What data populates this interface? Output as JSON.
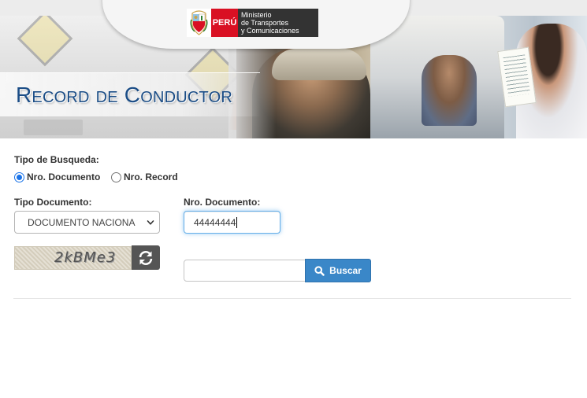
{
  "header": {
    "logo": {
      "country": "PERÚ",
      "ministry_lines": [
        "Ministerio",
        "de Transportes",
        "y Comunicaciones"
      ]
    },
    "title": "Record de Conductor"
  },
  "form": {
    "search_type": {
      "label": "Tipo de Busqueda:",
      "options": [
        {
          "label": "Nro. Documento",
          "checked": true
        },
        {
          "label": "Nro. Record",
          "checked": false
        }
      ]
    },
    "document_type": {
      "label": "Tipo Documento:",
      "selected": "DOCUMENTO NACIONA"
    },
    "document_number": {
      "label": "Nro. Documento:",
      "value": "44444444"
    },
    "captcha": {
      "image_text": "2kBMe3",
      "refresh_icon": "refresh-icon",
      "input_value": ""
    },
    "search_button": {
      "label": "Buscar",
      "icon": "search-icon"
    }
  },
  "colors": {
    "title_blue": "#1b4d86",
    "button_blue": "#3a87c8",
    "peru_red": "#d91023",
    "focus_border": "#66afe9"
  }
}
